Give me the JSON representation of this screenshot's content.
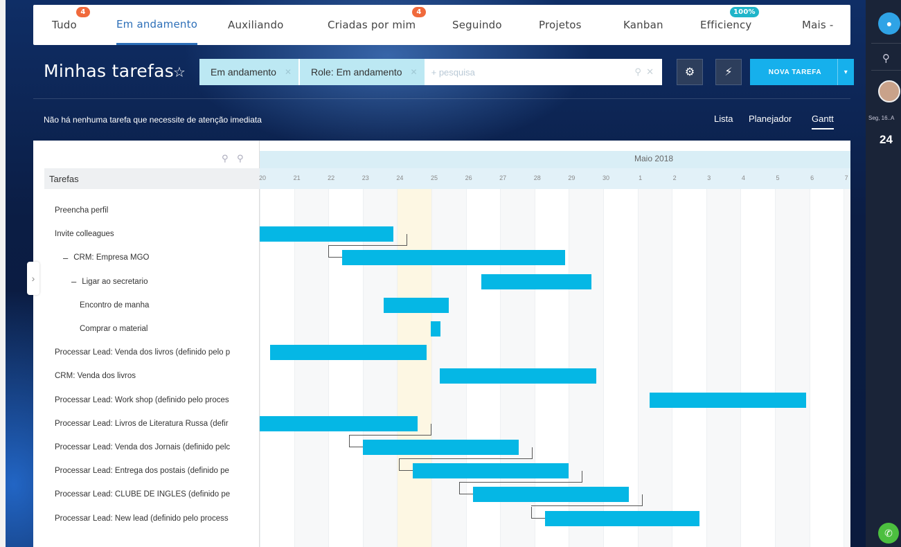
{
  "tabs": [
    {
      "label": "Tudo",
      "badge": "4"
    },
    {
      "label": "Em andamento",
      "badge": ""
    },
    {
      "label": "Auxiliando",
      "badge": ""
    },
    {
      "label": "Criadas por mim",
      "badge": "4"
    },
    {
      "label": "Seguindo",
      "badge": ""
    },
    {
      "label": "Projetos",
      "badge": ""
    },
    {
      "label": "Kanban",
      "badge": ""
    },
    {
      "label": "Efficiency",
      "badge": "100%"
    },
    {
      "label": "Mais -",
      "badge": ""
    }
  ],
  "active_tab": "Em andamento",
  "page_title": "Minhas tarefas",
  "filter": {
    "chips": [
      "Em andamento",
      "Role: Em andamento"
    ],
    "search_placeholder": "+ pesquisa"
  },
  "new_task_label": "NOVA TAREFA",
  "notice": "Não há nenhuma tarefa que necessite de atenção imediata",
  "views": [
    "Lista",
    "Planejador",
    "Gantt"
  ],
  "active_view": "Gantt",
  "gantt": {
    "column_header": "Tarefas",
    "month": "Maio 2018",
    "days": [
      "20",
      "21",
      "22",
      "23",
      "24",
      "25",
      "26",
      "27",
      "28",
      "29",
      "30",
      "1",
      "2",
      "3",
      "4",
      "5",
      "6",
      "7"
    ],
    "today": "24",
    "tasks": [
      {
        "name": "Preencha perfil",
        "indent": 0,
        "toggle": "",
        "start": null,
        "end": null
      },
      {
        "name": "Invite colleagues",
        "indent": 0,
        "toggle": "",
        "start": 0,
        "end": 3.9
      },
      {
        "name": "CRM: Empresa MGO",
        "indent": 1,
        "toggle": "–",
        "start": 2.4,
        "end": 8.9
      },
      {
        "name": "Ligar ao secretario",
        "indent": 2,
        "toggle": "–",
        "start": 6.45,
        "end": 9.65
      },
      {
        "name": "Encontro de manha",
        "indent": 3,
        "toggle": "",
        "start": 3.6,
        "end": 5.5
      },
      {
        "name": "Comprar o material",
        "indent": 3,
        "toggle": "",
        "start": 4.98,
        "end": 5.26
      },
      {
        "name": "Processar Lead: Venda dos livros (definido pelo p",
        "indent": 0,
        "toggle": "",
        "start": 0.3,
        "end": 4.85
      },
      {
        "name": "CRM: Venda dos livros",
        "indent": 0,
        "toggle": "",
        "start": 5.25,
        "end": 9.8
      },
      {
        "name": "Processar Lead: Work shop (definido pelo proces",
        "indent": 0,
        "toggle": "",
        "start": 11.35,
        "end": 15.9
      },
      {
        "name": "Processar Lead: Livros de Literatura Russa (defir",
        "indent": 0,
        "toggle": "",
        "start": 0,
        "end": 4.6
      },
      {
        "name": "Processar Lead: Venda dos Jornais (definido pelc",
        "indent": 0,
        "toggle": "",
        "start": 3.0,
        "end": 7.55
      },
      {
        "name": "Processar Lead: Entrega dos postais (definido pe",
        "indent": 0,
        "toggle": "",
        "start": 4.45,
        "end": 9.0
      },
      {
        "name": "Processar Lead: CLUBE DE INGLES (definido pe",
        "indent": 0,
        "toggle": "",
        "start": 6.2,
        "end": 10.75
      },
      {
        "name": "Processar Lead: New lead (definido pelo process",
        "indent": 0,
        "toggle": "",
        "start": 8.3,
        "end": 12.8
      }
    ]
  },
  "sidebar": {
    "date": "Seg, 16..A",
    "day_number": "24"
  },
  "colors": {
    "bar": "#05b7e5",
    "active_tab": "#2d6fb8",
    "badge": "#f06a3c",
    "efficiency_badge": "#1fb5c9",
    "new_task": "#16b0ec"
  },
  "icons": {
    "star": "☆",
    "gear": "⚙",
    "bolt": "⚡",
    "chevron_right": "›",
    "search": "⚲",
    "bell": "🔔",
    "phone": "✆"
  }
}
